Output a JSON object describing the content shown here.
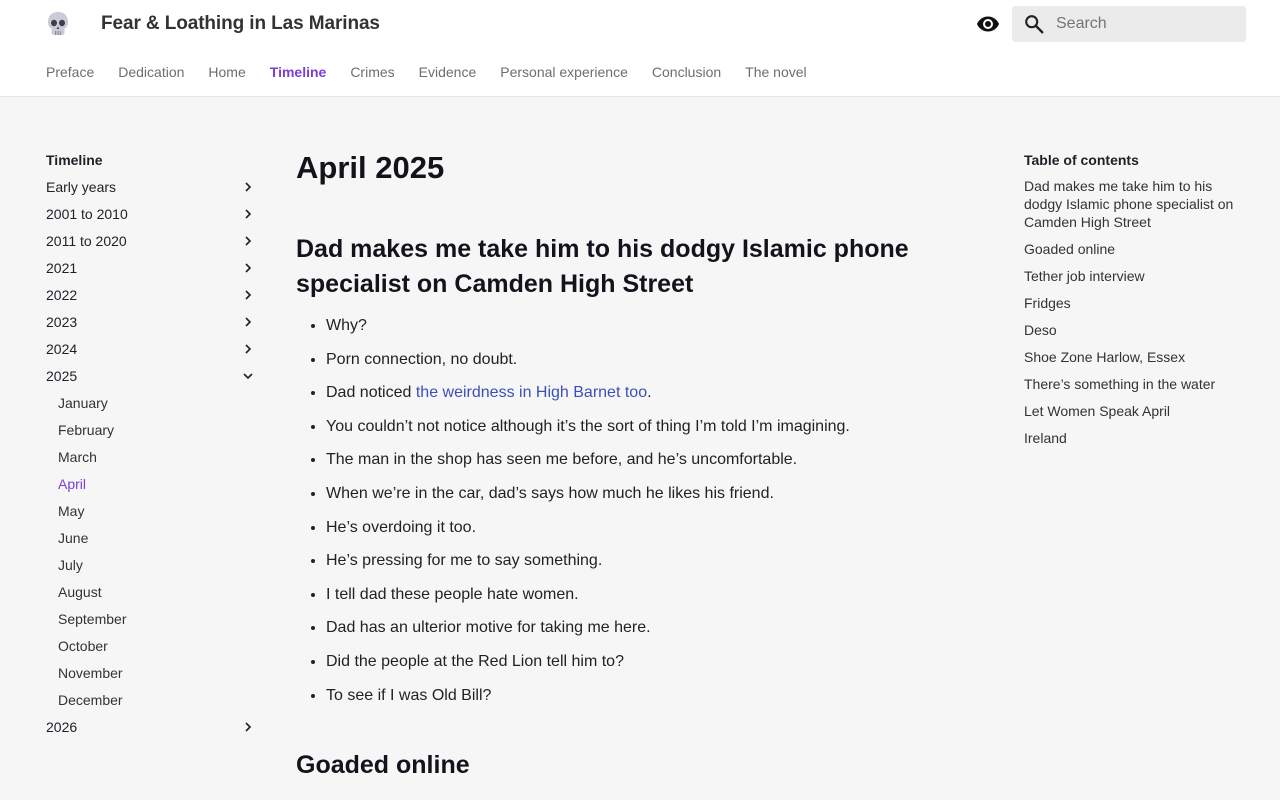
{
  "header": {
    "site_title": "Fear & Loathing in Las Marinas",
    "search_placeholder": "Search"
  },
  "topnav": [
    {
      "label": "Preface"
    },
    {
      "label": "Dedication"
    },
    {
      "label": "Home"
    },
    {
      "label": "Timeline",
      "active": true
    },
    {
      "label": "Crimes"
    },
    {
      "label": "Evidence"
    },
    {
      "label": "Personal experience"
    },
    {
      "label": "Conclusion"
    },
    {
      "label": "The novel"
    }
  ],
  "sidebar": {
    "heading": "Timeline",
    "items": [
      {
        "label": "Early years"
      },
      {
        "label": "2001 to 2010"
      },
      {
        "label": "2011 to 2020"
      },
      {
        "label": "2021"
      },
      {
        "label": "2022"
      },
      {
        "label": "2023"
      },
      {
        "label": "2024"
      },
      {
        "label": "2025",
        "expanded": true
      },
      {
        "label": "2026"
      }
    ],
    "months": [
      {
        "label": "January"
      },
      {
        "label": "February"
      },
      {
        "label": "March"
      },
      {
        "label": "April",
        "active": true
      },
      {
        "label": "May"
      },
      {
        "label": "June"
      },
      {
        "label": "July"
      },
      {
        "label": "August"
      },
      {
        "label": "September"
      },
      {
        "label": "October"
      },
      {
        "label": "November"
      },
      {
        "label": "December"
      }
    ]
  },
  "main": {
    "title": "April 2025",
    "section1_title": "Dad makes me take him to his dodgy Islamic phone specialist on Camden High Street",
    "bullets": [
      "Why?",
      "Porn connection, no doubt.",
      "You couldn’t not notice although it’s the sort of thing I’m told I’m imagining.",
      "The man in the shop has seen me before, and he’s uncomfortable.",
      "When we’re in the car, dad’s says how much he likes his friend.",
      "He’s overdoing it too.",
      "He’s pressing for me to say something.",
      "I tell dad these people hate women.",
      "Dad has an ulterior motive for taking me here.",
      "Did the people at the Red Lion tell him to?",
      "To see if I was Old Bill?"
    ],
    "link_bullet": {
      "prefix": "Dad noticed ",
      "link": "the weirdness in High Barnet too",
      "suffix": "."
    },
    "section2_title": "Goaded online"
  },
  "toc": {
    "heading": "Table of contents",
    "items": [
      "Dad makes me take him to his dodgy Islamic phone specialist on Camden High Street",
      "Goaded online",
      "Tether job interview",
      "Fridges",
      "Deso",
      "Shoe Zone Harlow, Essex",
      "There’s something in the water",
      "Let Women Speak April",
      "Ireland"
    ]
  },
  "colors": {
    "accent": "#7b3fd6",
    "link": "#3a50b8",
    "background": "#f6f6f6",
    "header_bg": "#ffffff"
  },
  "icons": {
    "logo": "skull-icon",
    "visibility": "eye-icon",
    "search": "search-icon",
    "expand": "chevron-right-icon",
    "collapse": "chevron-down-icon"
  }
}
